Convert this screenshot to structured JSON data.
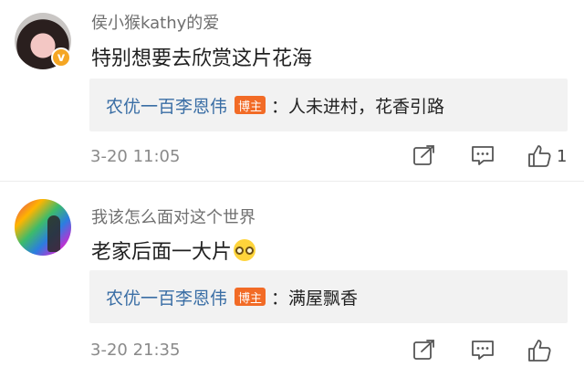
{
  "comments": [
    {
      "username": "侯小猴kathy的爱",
      "content": "特别想要去欣赏这片花海",
      "reply": {
        "name": "农优一百李恩伟",
        "tag": "博主",
        "text": "：人未进村，花香引路"
      },
      "time": "3-20 11:05",
      "like_count": "1",
      "verified_badge": "v"
    },
    {
      "username": "我该怎么面对这个世界",
      "content": "老家后面一大片",
      "emoji": "nerd-face-emoji",
      "reply": {
        "name": "农优一百李恩伟",
        "tag": "博主",
        "text": "：满屋飘香"
      },
      "time": "3-20 21:35",
      "like_count": ""
    }
  ],
  "icons": [
    "share-icon",
    "comment-icon",
    "like-icon"
  ],
  "colors": {
    "reply_name": "#3a6ea5",
    "host_tag": "#f26b26",
    "verified": "#f5a623"
  }
}
